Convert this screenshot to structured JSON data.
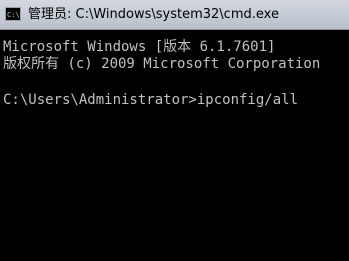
{
  "window": {
    "title": "管理员: C:\\Windows\\system32\\cmd.exe",
    "icon": "cmd-icon"
  },
  "console": {
    "lines": [
      "Microsoft Windows [版本 6.1.7601]",
      "版权所有 (c) 2009 Microsoft Corporation",
      "C:\\Users\\Administrator>ipconfig/all"
    ]
  },
  "colors": {
    "console_background": "#000000",
    "console_text": "#c0c0c0",
    "titlebar": "#c4cbd4"
  }
}
